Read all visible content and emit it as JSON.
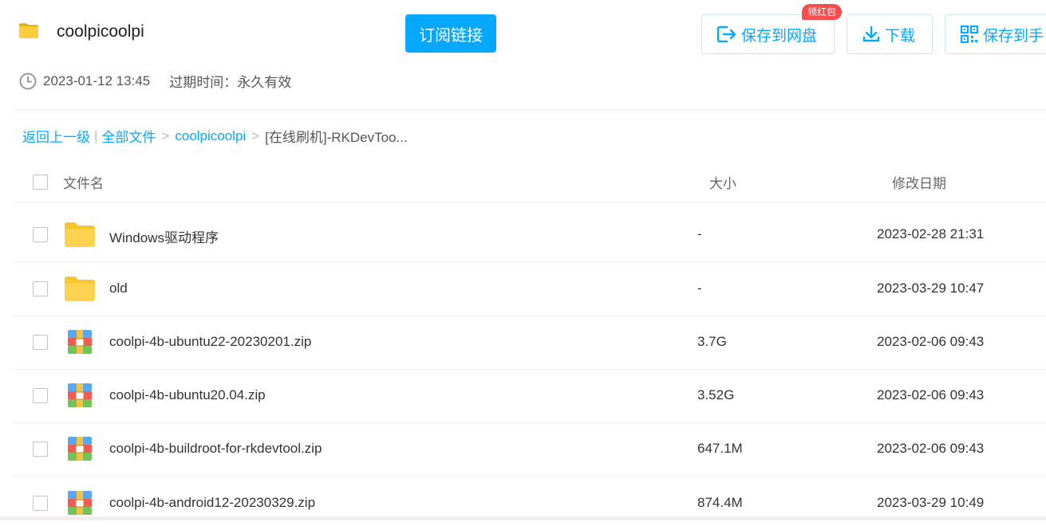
{
  "header": {
    "title": "coolpicoolpi",
    "subscribe_label": "订阅链接",
    "save_to_pan_label": "保存到网盘",
    "badge_label": "领红包",
    "download_label": "下载",
    "save_to_phone_label": "保存到手",
    "timestamp": "2023-01-12 13:45",
    "expire_text": "过期时间：永久有效"
  },
  "breadcrumb": {
    "back": "返回上一级",
    "pipe": "|",
    "all_files": "全部文件",
    "sep1": ">",
    "folder": "coolpicoolpi",
    "sep2": ">",
    "current": "[在线刷机]-RKDevToo..."
  },
  "list_header": {
    "name": "文件名",
    "size": "大小",
    "date": "修改日期"
  },
  "files": [
    {
      "name": "Windows驱动程序",
      "size": "-",
      "date": "2023-02-28 21:31",
      "type": "folder-icon"
    },
    {
      "name": "old",
      "size": "-",
      "date": "2023-03-29 10:47",
      "type": "folder-icon"
    },
    {
      "name": "coolpi-4b-ubuntu22-20230201.zip",
      "size": "3.7G",
      "date": "2023-02-06 09:43",
      "type": "zip-icon"
    },
    {
      "name": "coolpi-4b-ubuntu20.04.zip",
      "size": "3.52G",
      "date": "2023-02-06 09:43",
      "type": "zip-icon"
    },
    {
      "name": "coolpi-4b-buildroot-for-rkdevtool.zip",
      "size": "647.1M",
      "date": "2023-02-06 09:43",
      "type": "zip-icon"
    },
    {
      "name": "coolpi-4b-android12-20230329.zip",
      "size": "874.4M",
      "date": "2023-03-29 10:49",
      "type": "zip-icon"
    }
  ],
  "colors": {
    "accent": "#06a7ff",
    "badge": "#f74d4d",
    "folder": "#fdd250"
  }
}
